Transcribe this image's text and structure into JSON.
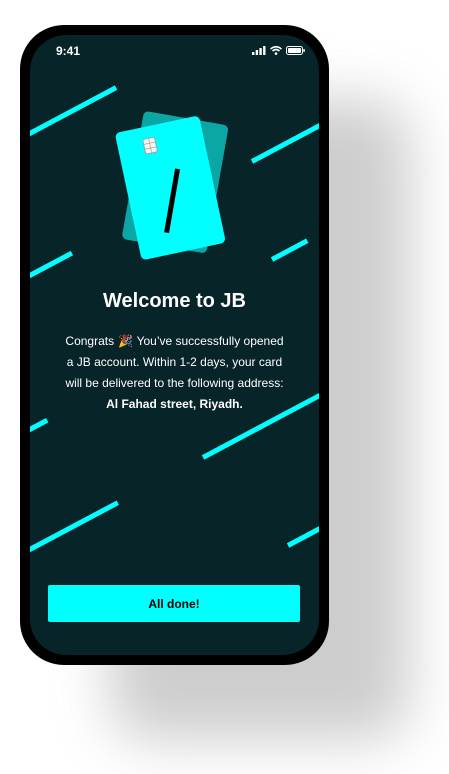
{
  "status_bar": {
    "time": "9:41"
  },
  "icons": {
    "signal": "cellular-signal-icon",
    "wifi": "wifi-icon",
    "battery": "battery-icon",
    "party": "party-popper-icon",
    "cards": "credit-cards-illustration"
  },
  "colors": {
    "background": "#072428",
    "accent": "#00FFFF",
    "card_back": "#0aa7a4",
    "phone_frame": "#000000"
  },
  "welcome": {
    "title": "Welcome to JB",
    "line1_prefix": "Congrats",
    "line1_suffix": "You’ve successfully opened",
    "line2": "a JB account. Within 1-2 days, your card",
    "line3": "will be delivered to the following address:",
    "address": "Al Fahad street, Riyadh."
  },
  "actions": {
    "done_label": "All done!"
  }
}
